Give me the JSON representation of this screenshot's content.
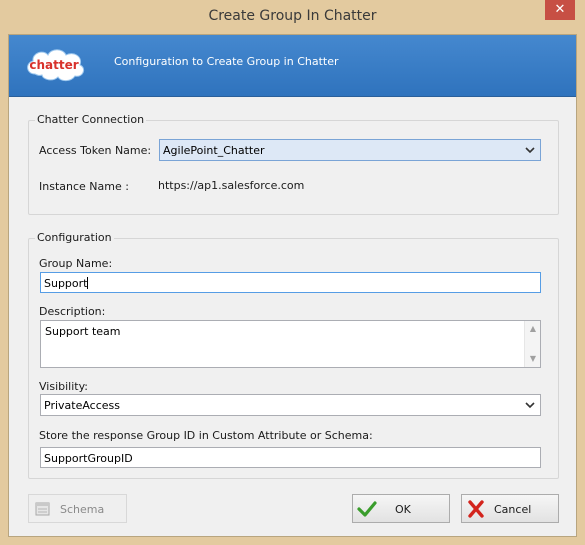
{
  "window": {
    "title": "Create Group In Chatter",
    "close_glyph": "✕"
  },
  "banner": {
    "logo_text": "chatter",
    "text": "Configuration to Create Group in Chatter",
    "color": "#3a7fc6"
  },
  "connection": {
    "legend": "Chatter Connection",
    "token_label": "Access Token Name:",
    "token_value": "AgilePoint_Chatter",
    "instance_label": "Instance Name :",
    "instance_value": "https://ap1.salesforce.com"
  },
  "configuration": {
    "legend": "Configuration",
    "group_name_label": "Group Name:",
    "group_name_value": "Support",
    "description_label": "Description:",
    "description_value": "Support team",
    "visibility_label": "Visibility:",
    "visibility_value": "PrivateAccess",
    "store_label": "Store the response Group ID in Custom Attribute or Schema:",
    "store_value": "SupportGroupID"
  },
  "buttons": {
    "schema_label": "Schema",
    "ok_label": "OK",
    "cancel_label": "Cancel"
  },
  "icons": {
    "close": "close-icon",
    "dropdown": "chevron-down-icon",
    "schema": "schema-icon",
    "ok": "checkmark-icon",
    "cancel": "x-icon"
  }
}
